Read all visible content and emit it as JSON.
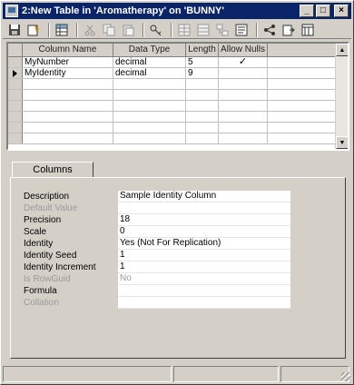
{
  "window": {
    "title": "2:New Table in 'Aromatherapy' on 'BUNNY'"
  },
  "title_buttons": {
    "minimize": "_",
    "maximize": "□",
    "close": "×"
  },
  "toolbar": {
    "icons": [
      "save-icon",
      "properties-icon",
      "table-icon",
      "cut-icon",
      "copy-icon",
      "paste-icon",
      "key-icon",
      "insert-column-icon",
      "delete-column-icon",
      "relationships-icon",
      "indexes-icon",
      "constraints-icon",
      "generate-script-icon",
      "change-type-icon",
      "table-view-icon"
    ]
  },
  "grid": {
    "headers": [
      "Column Name",
      "Data Type",
      "Length",
      "Allow Nulls"
    ],
    "rows": [
      {
        "name": "MyNumber",
        "type": "decimal",
        "length": "5",
        "nulls": "✓"
      },
      {
        "name": "MyIdentity",
        "type": "decimal",
        "length": "9",
        "nulls": ""
      }
    ]
  },
  "tabs": {
    "columns": "Columns"
  },
  "properties": [
    {
      "label": "Description",
      "value": "Sample Identity Column"
    },
    {
      "label": "Default Value",
      "value": ""
    },
    {
      "label": "Precision",
      "value": "18"
    },
    {
      "label": "Scale",
      "value": "0"
    },
    {
      "label": "Identity",
      "value": "Yes (Not For Replication)"
    },
    {
      "label": "Identity Seed",
      "value": "1"
    },
    {
      "label": "Identity Increment",
      "value": "1"
    },
    {
      "label": "Is RowGuid",
      "value": "No"
    },
    {
      "label": "Formula",
      "value": ""
    },
    {
      "label": "Collation",
      "value": ""
    }
  ]
}
